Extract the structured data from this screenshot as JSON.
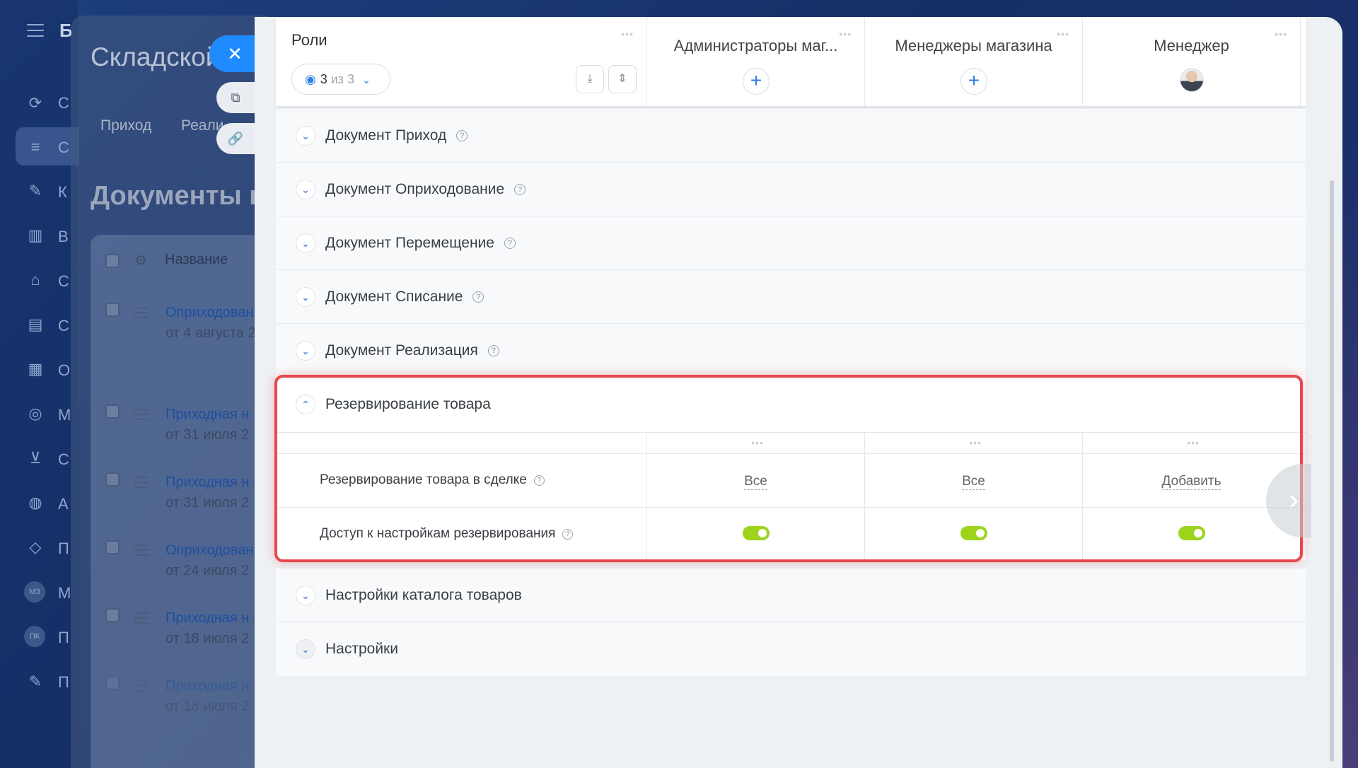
{
  "app": {
    "logo_letter": "Б"
  },
  "sidebar": {
    "letters": [
      "С",
      "С",
      "К",
      "В",
      "С",
      "С",
      "О",
      "М",
      "С",
      "А",
      "П",
      "М",
      "П",
      "П"
    ],
    "badges": [
      "МЗ",
      "ПК"
    ]
  },
  "background": {
    "title": "Складской",
    "tabs": [
      "Приход",
      "Реали"
    ],
    "heading": "Документы п",
    "table_header": "Название",
    "rows": [
      {
        "title": "Оприходован",
        "sub": "от 4 августа 2"
      },
      {
        "title": "Приходная н",
        "sub": "от 31 июля 2"
      },
      {
        "title": "Приходная н",
        "sub": "от 31 июля 2"
      },
      {
        "title": "Оприходован",
        "sub": "от 24 июля 2"
      },
      {
        "title": "Приходная н",
        "sub": "от 18 июля 2"
      },
      {
        "title": "Приходная н",
        "sub": "от 18 июля 2"
      }
    ]
  },
  "header": {
    "roles_title": "Роли",
    "roles_count": "3",
    "roles_of": "из 3",
    "columns": [
      {
        "name": "Администраторы маг..."
      },
      {
        "name": "Менеджеры магазина"
      },
      {
        "name": "Менеджер"
      }
    ]
  },
  "sections": [
    {
      "label": "Документ Приход"
    },
    {
      "label": "Документ Оприходование"
    },
    {
      "label": "Документ Перемещение"
    },
    {
      "label": "Документ Списание"
    },
    {
      "label": "Документ Реализация"
    }
  ],
  "expanded": {
    "label": "Резервирование товара",
    "rows": [
      {
        "label": "Резервирование товара в сделке",
        "values": [
          "Все",
          "Все",
          "Добавить"
        ]
      },
      {
        "label": "Доступ к настройкам резервирования",
        "toggles": [
          true,
          true,
          true
        ]
      }
    ]
  },
  "bottom_sections": [
    {
      "label": "Настройки каталога товаров"
    },
    {
      "label": "Настройки"
    }
  ],
  "colors": {
    "accent": "#2e7de1",
    "toggle_on": "#9cd41c",
    "highlight": "#e5484d"
  }
}
